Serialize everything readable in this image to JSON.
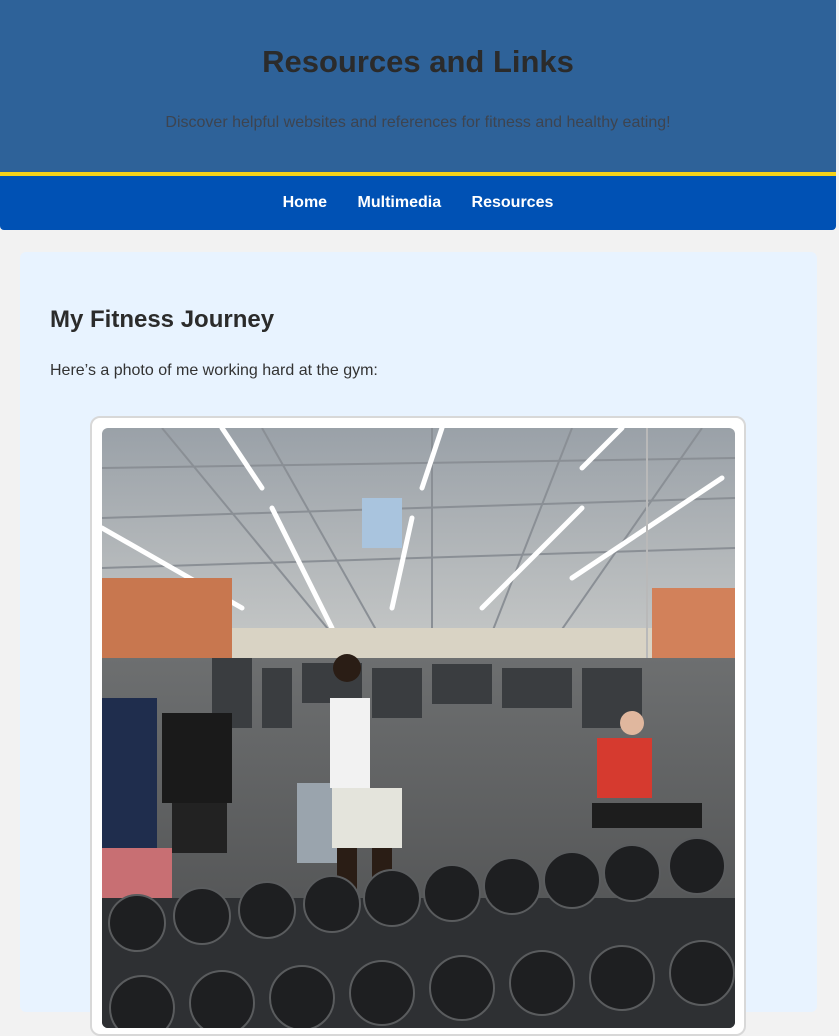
{
  "header": {
    "title": "Resources and Links",
    "subtitle": "Discover helpful websites and references for fitness and healthy eating!"
  },
  "nav": {
    "items": [
      {
        "label": "Home"
      },
      {
        "label": "Multimedia"
      },
      {
        "label": "Resources"
      }
    ]
  },
  "main": {
    "heading": "My Fitness Journey",
    "intro": "Here’s a photo of me working hard at the gym:"
  },
  "colors": {
    "header_bg": "#2e6299",
    "nav_bg": "#0051b4",
    "nav_accent": "#f5d21a",
    "content_bg": "#e8f3ff"
  }
}
